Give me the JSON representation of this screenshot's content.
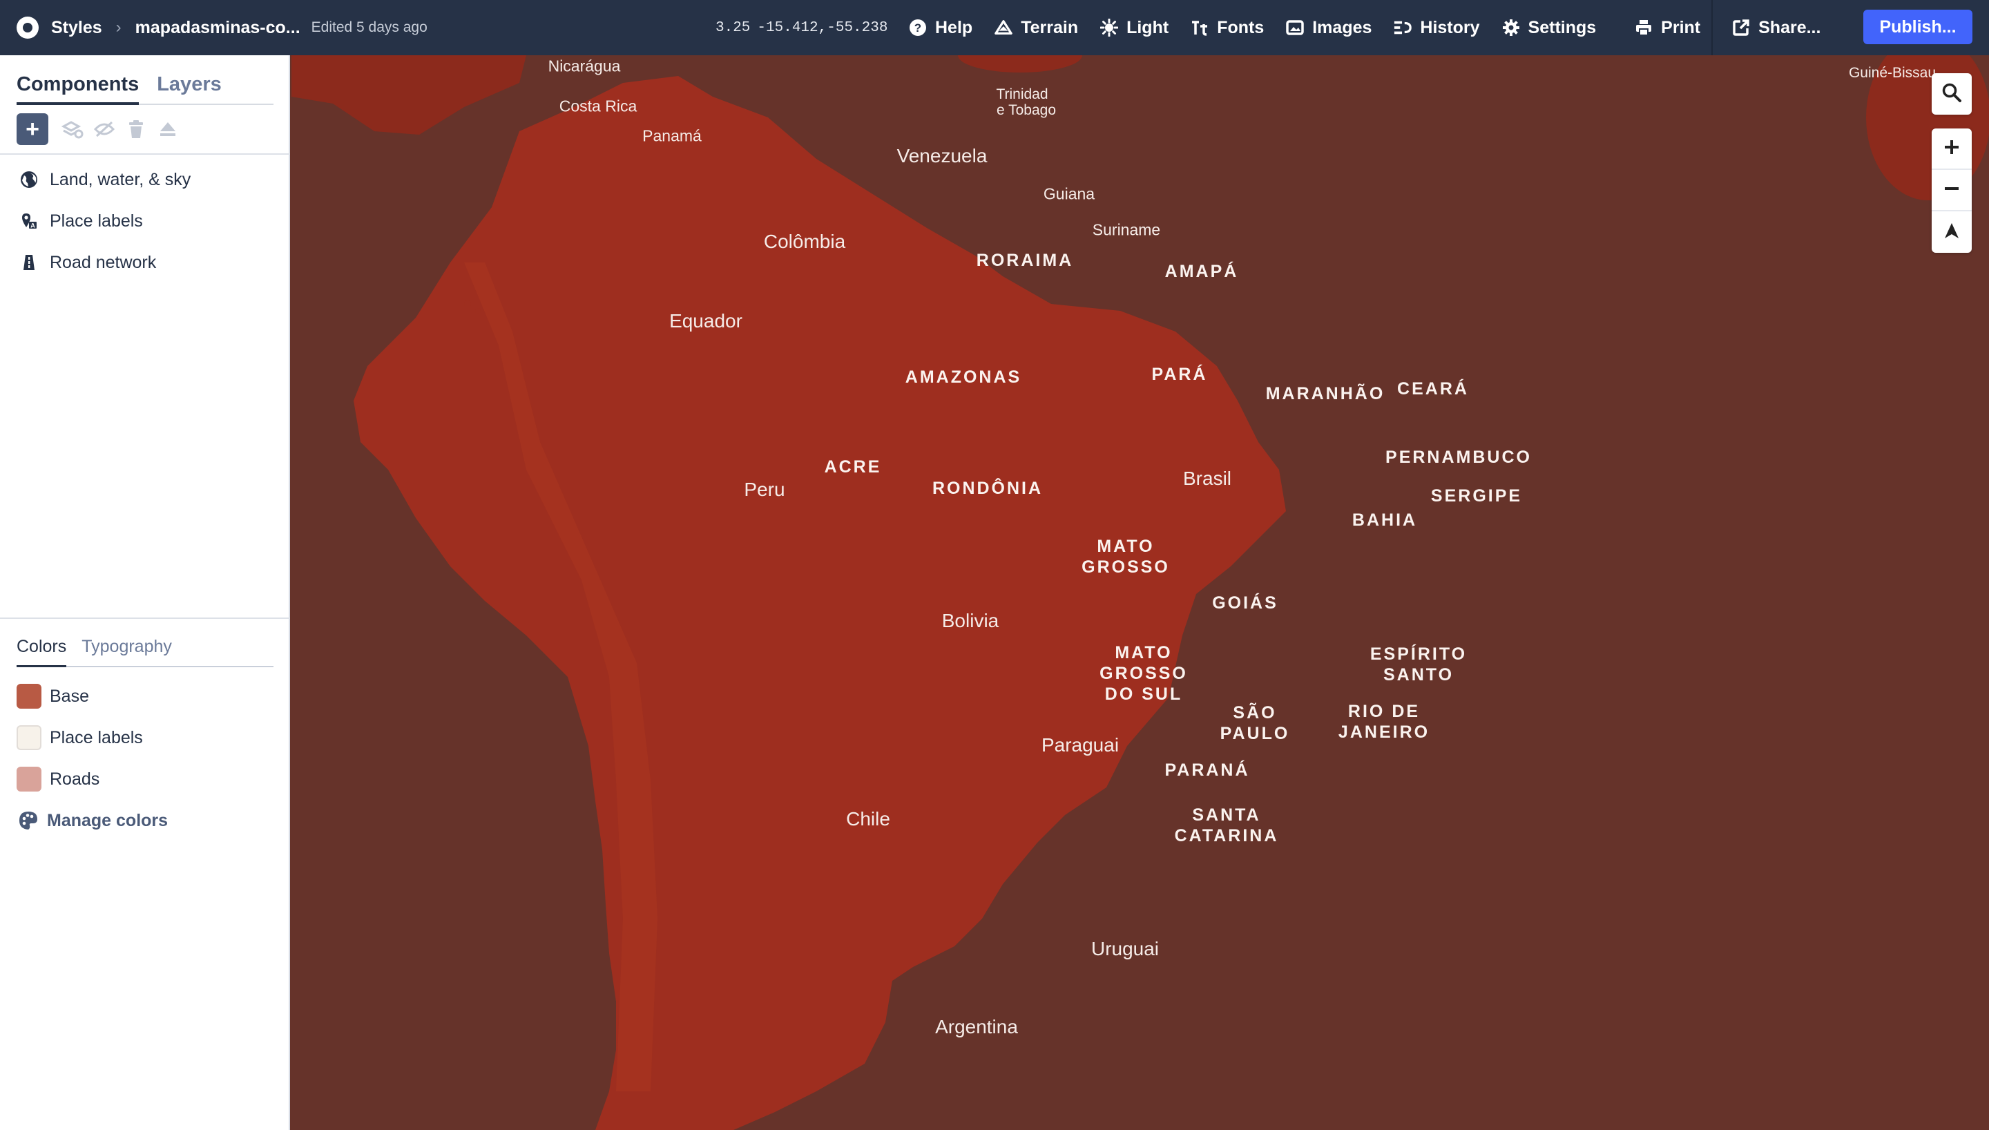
{
  "topbar": {
    "styles_label": "Styles",
    "style_name": "mapadasminas-co...",
    "edited": "Edited 5 days ago",
    "zoom": "3.25",
    "center": "-15.412,-55.238",
    "actions": [
      {
        "label": "Help",
        "icon": "help-icon"
      },
      {
        "label": "Terrain",
        "icon": "terrain-icon"
      },
      {
        "label": "Light",
        "icon": "light-icon"
      },
      {
        "label": "Fonts",
        "icon": "fonts-icon"
      },
      {
        "label": "Images",
        "icon": "images-icon"
      },
      {
        "label": "History",
        "icon": "history-icon"
      },
      {
        "label": "Settings",
        "icon": "settings-icon"
      },
      {
        "label": "Print",
        "icon": "print-icon"
      },
      {
        "label": "Share...",
        "icon": "share-icon"
      }
    ],
    "publish": "Publish..."
  },
  "sidebar": {
    "tabs": [
      "Components",
      "Layers"
    ],
    "components": [
      {
        "label": "Land, water, & sky",
        "icon": "globe-icon"
      },
      {
        "label": "Place labels",
        "icon": "place-labels-icon"
      },
      {
        "label": "Road network",
        "icon": "road-icon"
      }
    ],
    "bottom_tabs": [
      "Colors",
      "Typography"
    ],
    "colors": [
      {
        "label": "Base",
        "swatch": "#b85a44"
      },
      {
        "label": "Place labels",
        "swatch": "#f7f2ea"
      },
      {
        "label": "Roads",
        "swatch": "#d9a39a"
      }
    ],
    "manage_colors": "Manage colors"
  },
  "map": {
    "colors": {
      "water": "#66332a",
      "land": "#9e2e1f",
      "land_dark": "#8c2a1c"
    },
    "countries": {
      "nicaragua": "Nicarágua",
      "costa_rica": "Costa Rica",
      "panama": "Panamá",
      "venezuela": "Venezuela",
      "trinidad_1": "Trinidad",
      "trinidad_2": "e Tobago",
      "guiana": "Guiana",
      "suriname": "Suriname",
      "colombia": "Colômbia",
      "equador": "Equador",
      "peru": "Peru",
      "brasil": "Brasil",
      "bolivia": "Bolivia",
      "paraguai": "Paraguai",
      "chile": "Chile",
      "uruguai": "Uruguai",
      "argentina": "Argentina",
      "guine_bissau": "Guiné-Bissau"
    },
    "states": {
      "roraima": "RORAIMA",
      "amapa": "AMAPÁ",
      "amazonas": "AMAZONAS",
      "para": "PARÁ",
      "maranhao": "MARANHÃO",
      "ceara": "CEARÁ",
      "acre": "ACRE",
      "rondonia": "RONDÔNIA",
      "pernambuco": "PERNAMBUCO",
      "sergipe": "SERGIPE",
      "bahia": "BAHIA",
      "mato_grosso_1": "MATO",
      "mato_grosso_2": "GROSSO",
      "goias": "GOIÁS",
      "ms_1": "MATO",
      "ms_2": "GROSSO",
      "ms_3": "DO SUL",
      "es_1": "ESPÍRITO",
      "es_2": "SANTO",
      "sp_1": "SÃO",
      "sp_2": "PAULO",
      "rj_1": "RIO DE",
      "rj_2": "JANEIRO",
      "parana": "PARANÁ",
      "sc_1": "SANTA",
      "sc_2": "CATARINA"
    },
    "controls": [
      "search-icon",
      "zoom-in-icon",
      "zoom-out-icon",
      "compass-icon"
    ]
  }
}
